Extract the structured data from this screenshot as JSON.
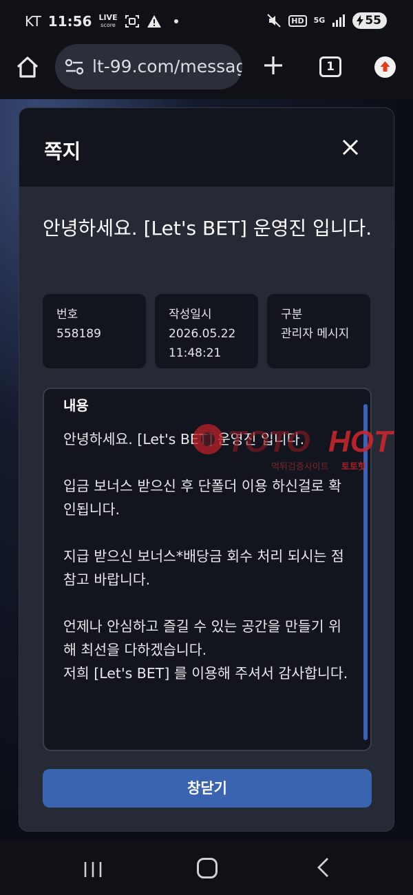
{
  "status_bar": {
    "carrier": "KT",
    "time": "11:56",
    "live_line1": "LIVE",
    "live_line2": "score",
    "hd_label": "HD",
    "network": "5G",
    "battery": "55"
  },
  "browser": {
    "url": "lt-99.com/messag",
    "tab_count": "1"
  },
  "modal": {
    "title": "쪽지",
    "message_title": "안녕하세요. [Let's BET] 운영진 입니다.",
    "info": [
      {
        "label": "번호",
        "value": "558189"
      },
      {
        "label": "작성일시",
        "value": "2026.05.22 11:48:21"
      },
      {
        "label": "구분",
        "value": "관리자 메시지"
      }
    ],
    "content_label": "내용",
    "content": {
      "line1": "안녕하세요. [Let's BET] 운영진 입니다.",
      "line2": "입금 보너스 받으신 후 단폴더 이용 하신걸로 확인됩니다.",
      "line3": "지급 받으신 보너스*배당금 회수 처리 되시는 점 참고 바랍니다.",
      "line4": "언제나 안심하고 즐길 수 있는 공간을 만들기 위해 최선을 다하겠습니다.",
      "line5": "저희 [Let's BET] 를 이용해 주셔서 감사합니다."
    },
    "close_window_label": "창닫기"
  },
  "watermark": {
    "brand_a": "TOTO",
    "brand_b": "HOT",
    "tagline_a": "먹튀검증사이트",
    "tagline_b": "토토핫"
  },
  "colors": {
    "accent": "#3a64b0",
    "panel": "#262a35",
    "panel_dark": "#12151d"
  }
}
